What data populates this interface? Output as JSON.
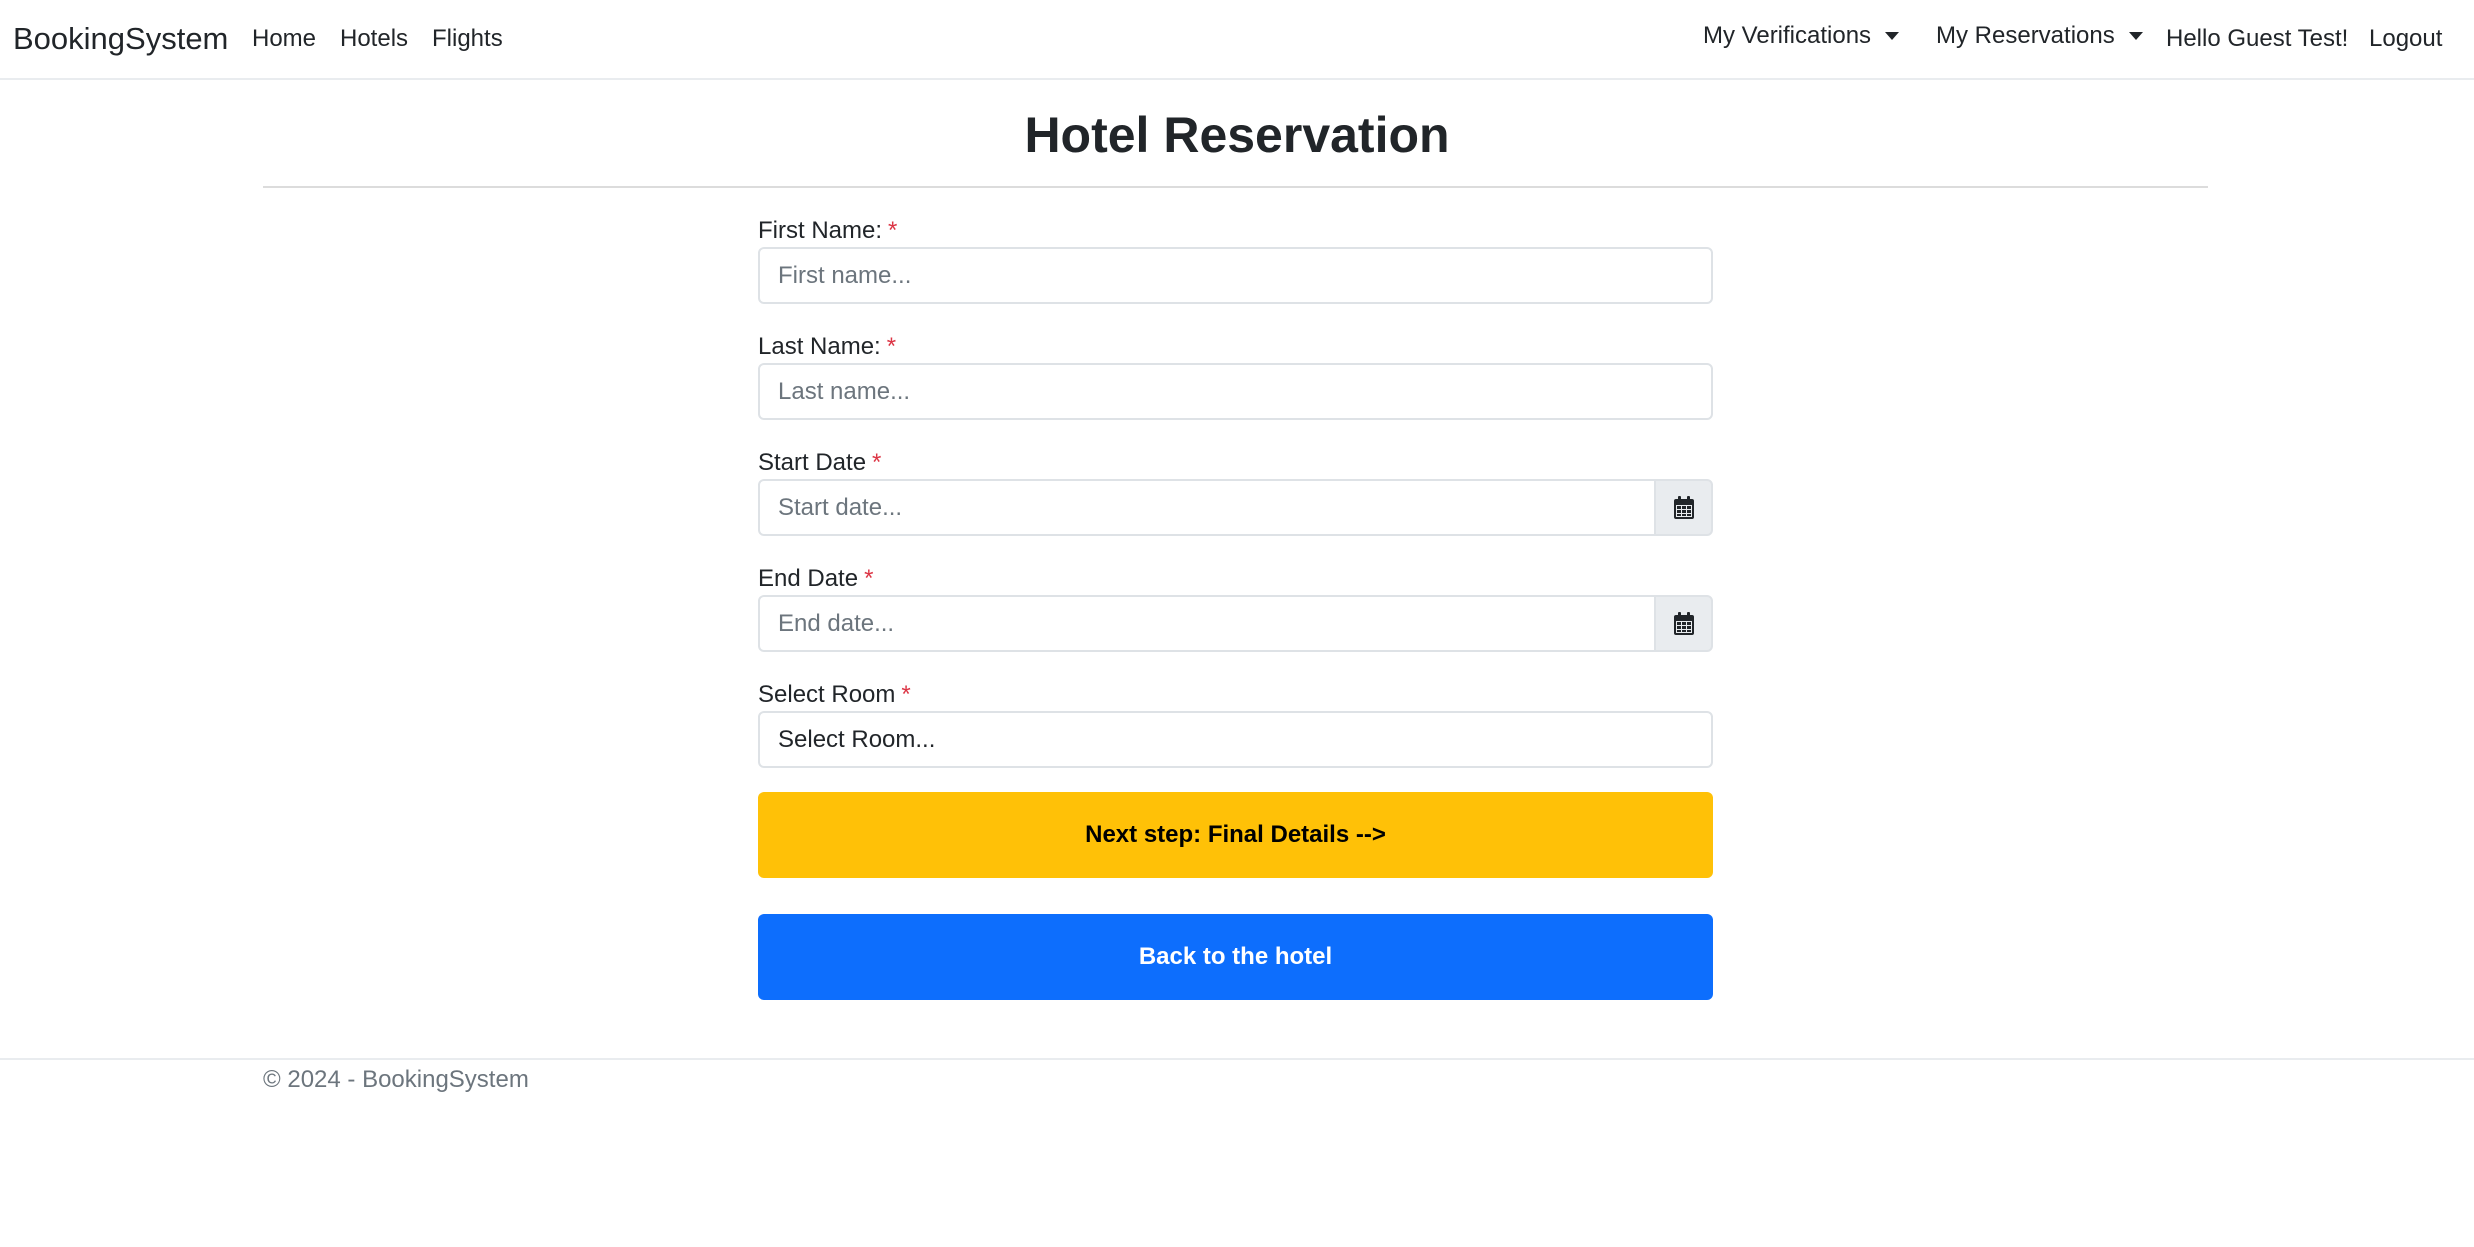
{
  "navbar": {
    "brand": "BookingSystem",
    "links": [
      "Home",
      "Hotels",
      "Flights"
    ],
    "my_verifications": "My Verifications",
    "my_reservations": "My Reservations",
    "greeting": "Hello Guest Test!",
    "logout": "Logout"
  },
  "page": {
    "title": "Hotel Reservation"
  },
  "form": {
    "required_mark": "*",
    "first_name": {
      "label": "First Name:",
      "placeholder": "First name...",
      "value": ""
    },
    "last_name": {
      "label": "Last Name:",
      "placeholder": "Last name...",
      "value": ""
    },
    "start_date": {
      "label": "Start Date",
      "placeholder": "Start date...",
      "value": "",
      "icon": "calendar-icon"
    },
    "end_date": {
      "label": "End Date",
      "placeholder": "End date...",
      "value": "",
      "icon": "calendar-icon"
    },
    "room": {
      "label": "Select Room",
      "selected": "Select Room..."
    },
    "next_button": "Next step: Final Details -->",
    "back_button": "Back to the hotel"
  },
  "footer": {
    "text": "© 2024 - BookingSystem"
  },
  "colors": {
    "next_button_bg": "#ffc107",
    "back_button_bg": "#0d6efd",
    "required": "#dc3545"
  }
}
